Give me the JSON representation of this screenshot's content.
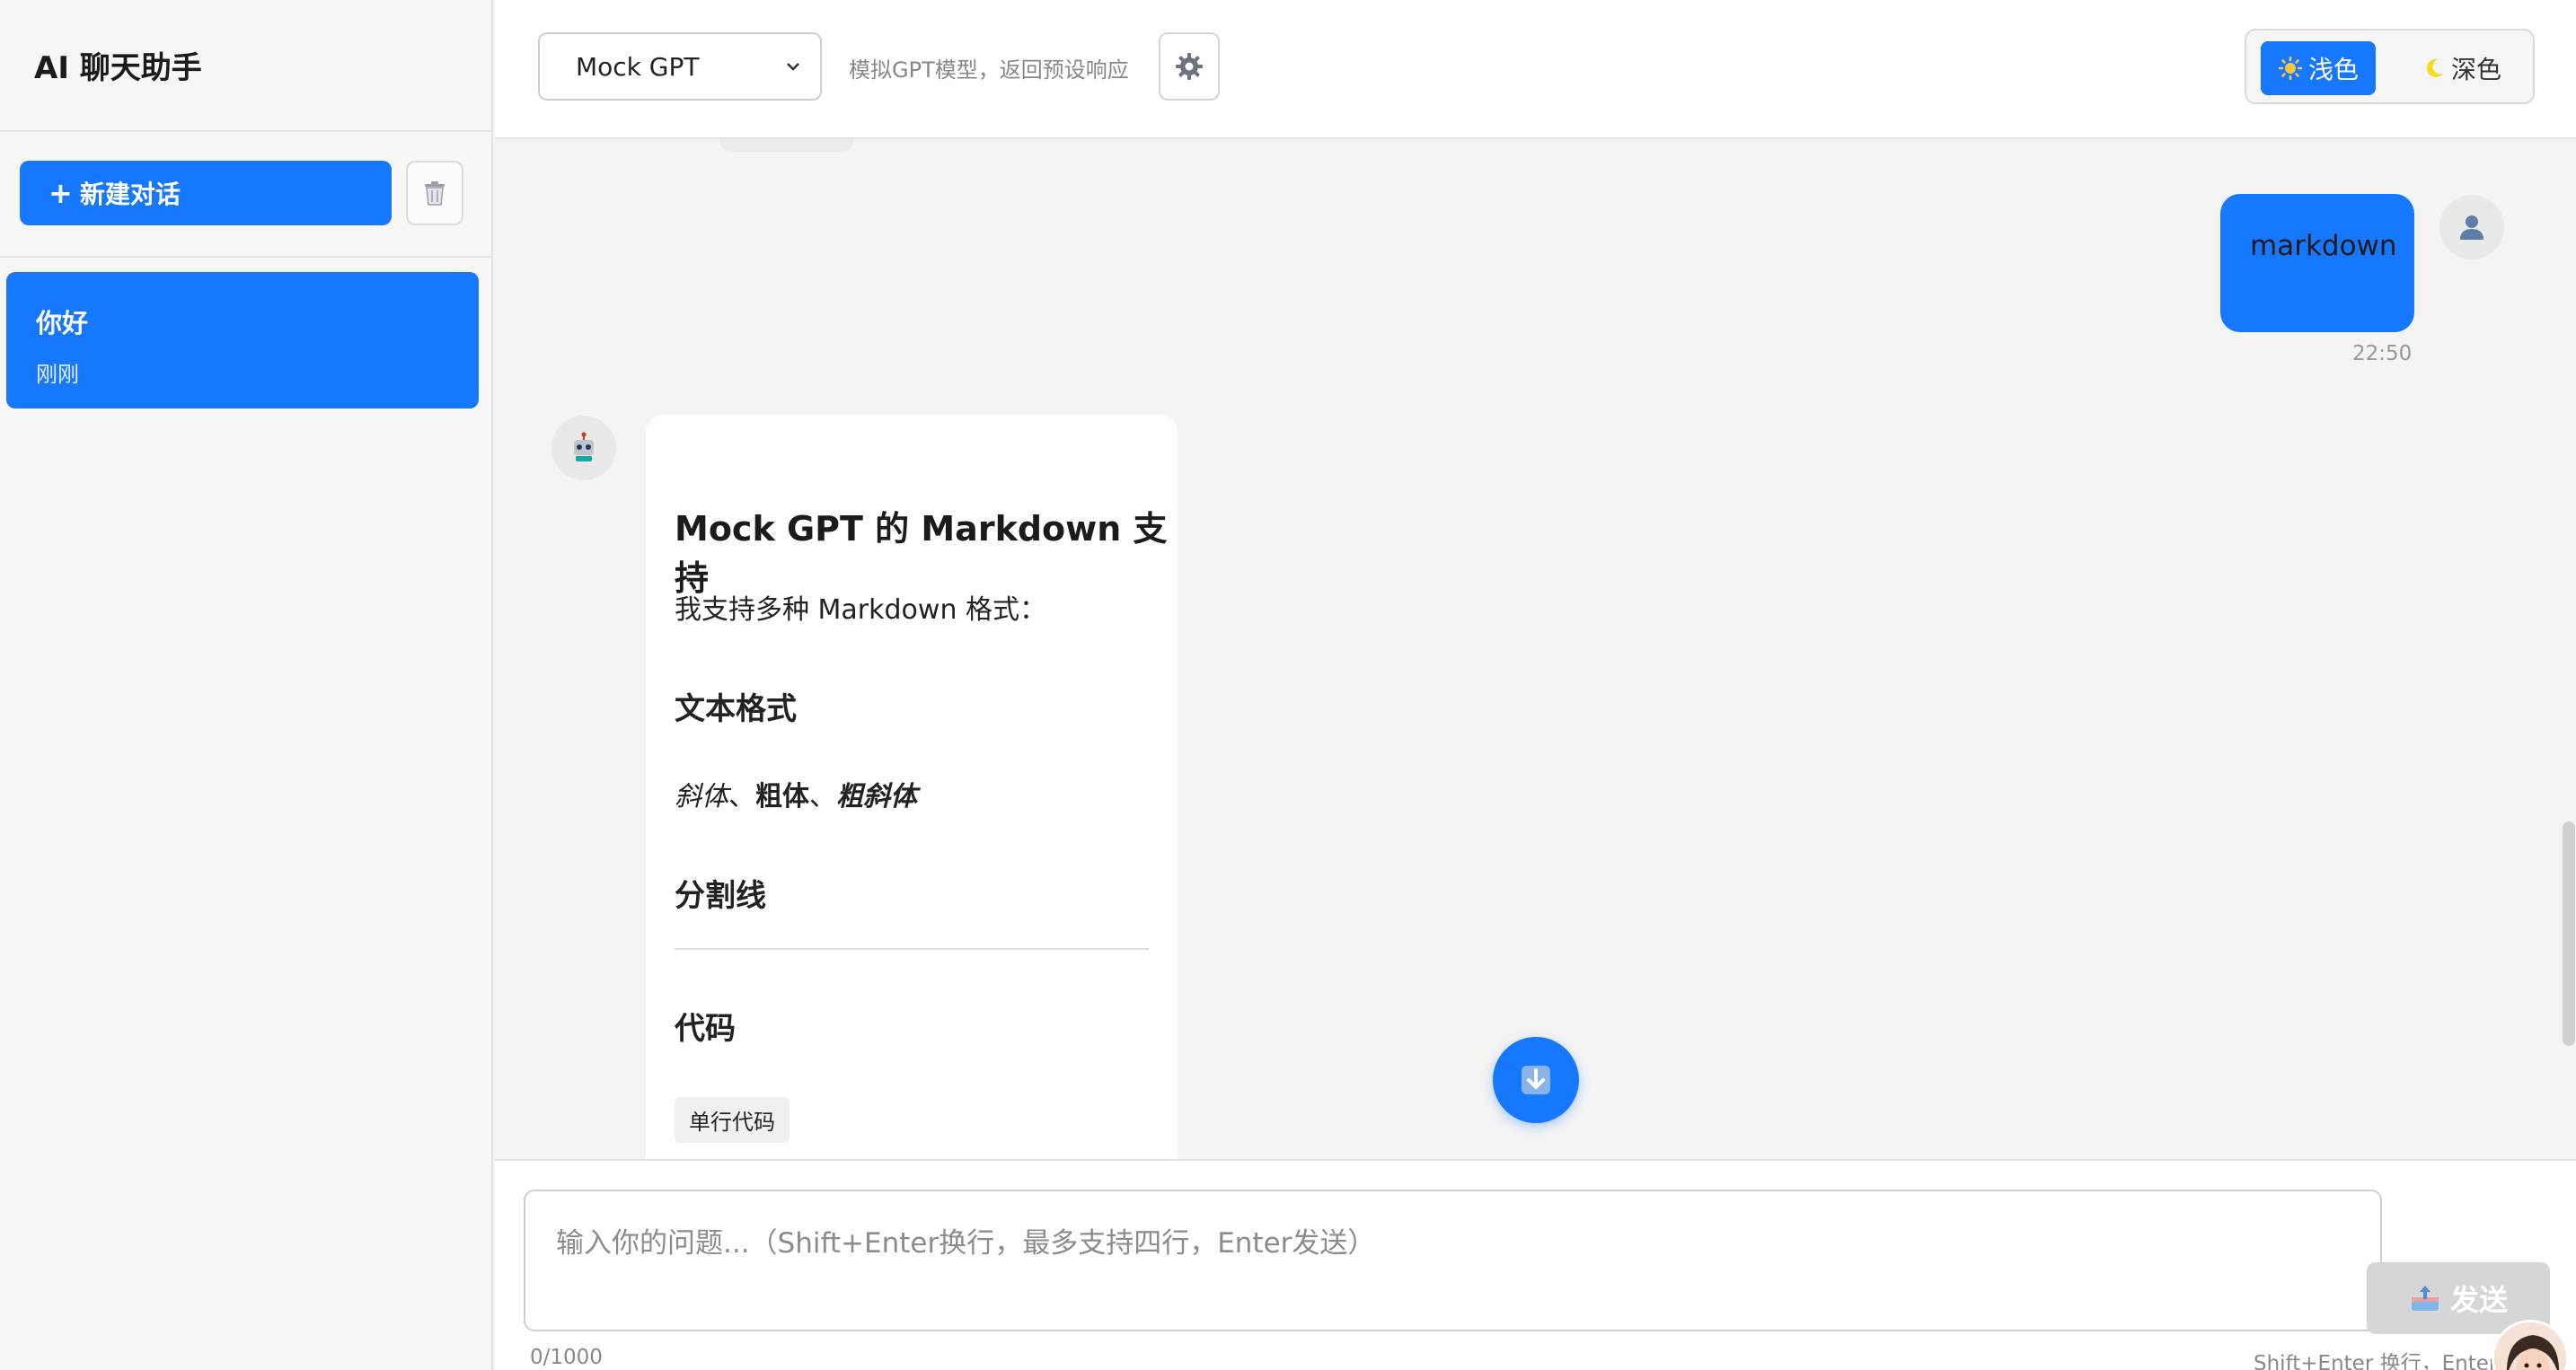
{
  "sidebar": {
    "app_title": "AI 聊天助手",
    "new_chat_label": "新建对话",
    "conversations": [
      {
        "title": "你好",
        "time": "刚刚"
      }
    ]
  },
  "header": {
    "model_selected": "Mock GPT",
    "model_description": "模拟GPT模型，返回预设响应",
    "theme_light_label": "浅色",
    "theme_dark_label": "深色"
  },
  "chat": {
    "user_message": "markdown",
    "user_message_time": "22:50",
    "bot_message": {
      "h1": "Mock GPT 的 Markdown 支持",
      "intro": "我支持多种 Markdown 格式：",
      "section_text_format": "文本格式",
      "italic": "斜体",
      "sep1": "、",
      "bold": "粗体",
      "sep2": "、",
      "bold_italic": "粗斜体",
      "section_divider": "分割线",
      "section_code": "代码",
      "inline_code": "单行代码"
    }
  },
  "input": {
    "placeholder": "输入你的问题...（Shift+Enter换行，最多支持四行，Enter发送）",
    "char_count": "0/1000",
    "send_label": "发送",
    "hint": "Shift+Enter 换行，Enter"
  },
  "colors": {
    "accent": "#1677ff",
    "send_disabled": "#d6d6d6"
  }
}
